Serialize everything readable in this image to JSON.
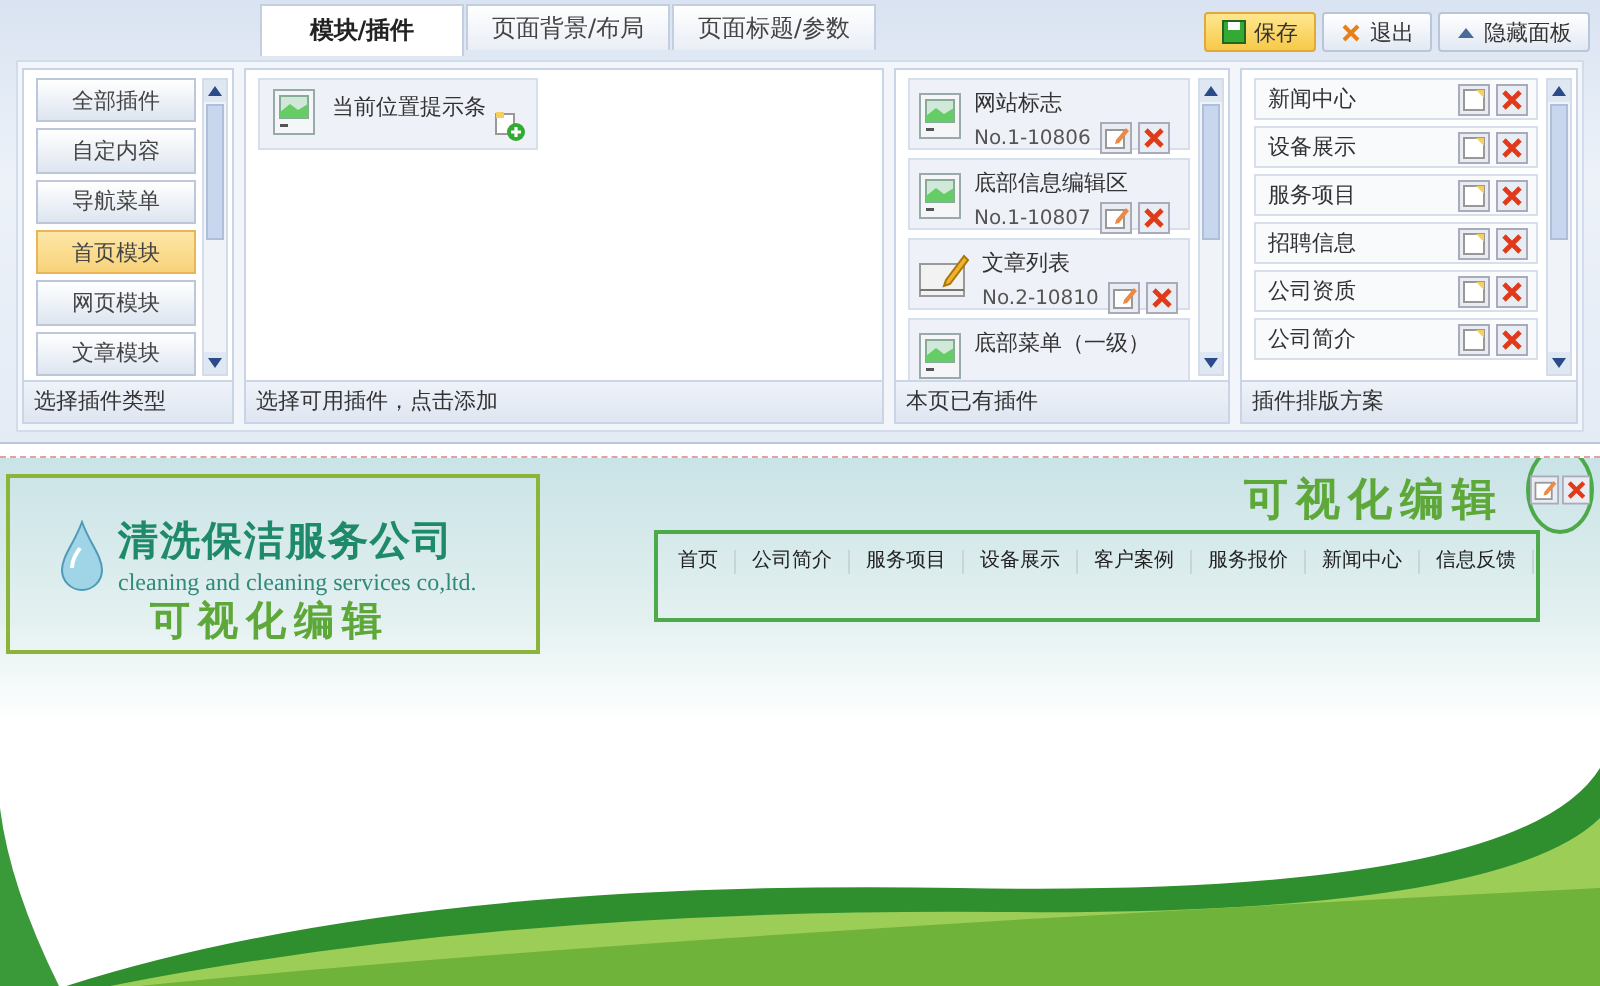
{
  "tabs": [
    {
      "label": "模块/插件",
      "selected": true
    },
    {
      "label": "页面背景/布局",
      "selected": false
    },
    {
      "label": "页面标题/参数",
      "selected": false
    }
  ],
  "toolbar_buttons": [
    {
      "label": "保存",
      "kind": "save"
    },
    {
      "label": "退出",
      "kind": "exit"
    },
    {
      "label": "隐藏面板",
      "kind": "hide"
    }
  ],
  "plugin_types": {
    "items": [
      {
        "label": "全部插件",
        "selected": false
      },
      {
        "label": "自定内容",
        "selected": false
      },
      {
        "label": "导航菜单",
        "selected": false
      },
      {
        "label": "首页模块",
        "selected": true
      },
      {
        "label": "网页模块",
        "selected": false
      },
      {
        "label": "文章模块",
        "selected": false
      }
    ],
    "footer": "选择插件类型"
  },
  "available_plugins": {
    "items": [
      {
        "name": "当前位置提示条"
      }
    ],
    "footer": "选择可用插件，点击添加"
  },
  "page_plugins": {
    "items": [
      {
        "name": "网站标志",
        "number": "No.1-10806",
        "kind": "image"
      },
      {
        "name": "底部信息编辑区",
        "number": "No.1-10807",
        "kind": "image"
      },
      {
        "name": "文章列表",
        "number": "No.2-10810",
        "kind": "article"
      },
      {
        "name": "底部菜单（一级）",
        "kind": "image"
      }
    ],
    "footer": "本页已有插件"
  },
  "layout_plan": {
    "items": [
      {
        "name": "新闻中心"
      },
      {
        "name": "设备展示"
      },
      {
        "name": "服务项目"
      },
      {
        "name": "招聘信息"
      },
      {
        "name": "公司资质"
      },
      {
        "name": "公司简介"
      }
    ],
    "footer": "插件排版方案"
  },
  "preview": {
    "logo": {
      "title": "清洗保洁服务公司",
      "subtitle": "cleaning and cleaning services co,ltd.",
      "annotation": "可视化编辑"
    },
    "header_annotation": "可视化编辑",
    "nav": [
      "首页",
      "公司简介",
      "服务项目",
      "设备展示",
      "客户案例",
      "服务报价",
      "新闻中心",
      "信息反馈"
    ]
  }
}
